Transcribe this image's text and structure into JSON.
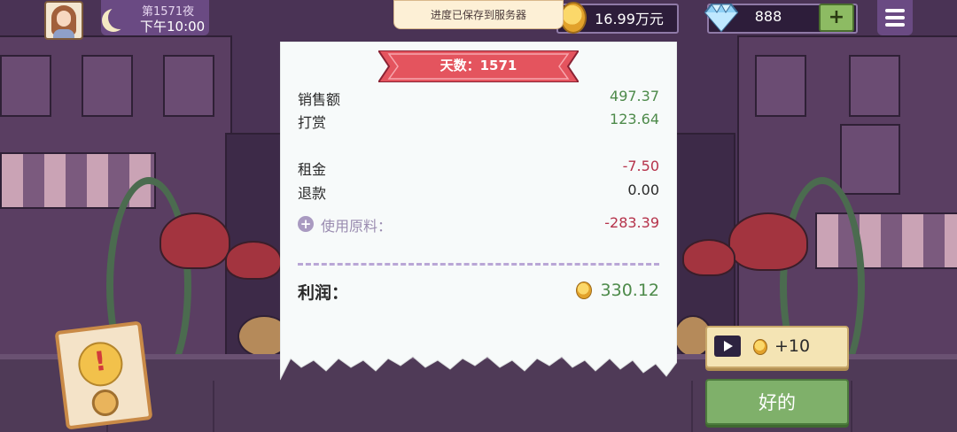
{
  "hud": {
    "day_label": "第1571夜",
    "time_label": "下午10:00",
    "save_toast": "进度已保存到服务器",
    "money": "16.99万元",
    "gems": "888",
    "plus_label": "+"
  },
  "receipt": {
    "title": "天数：1571",
    "rows": [
      {
        "label": "销售额",
        "value": "497.37"
      },
      {
        "label": "打赏",
        "value": "123.64"
      },
      {
        "label": "租金",
        "value": "-7.50"
      },
      {
        "label": "退款",
        "value": "0.00"
      }
    ],
    "materials": {
      "plus": "+",
      "label": "使用原料：",
      "value": "-283.39"
    },
    "profit": {
      "label": "利润：",
      "value": "330.12"
    }
  },
  "alert_card": {
    "mark": "!"
  },
  "buttons": {
    "ad_reward": "+10",
    "ok": "好的"
  },
  "colors": {
    "income_green": "#4d8a4a",
    "expense_red": "#b5324a",
    "ok_button": "#7fb06a",
    "ribbon_red": "#e4545e"
  },
  "icons": [
    "moon-icon",
    "coin-icon",
    "diamond-icon",
    "plus-icon",
    "menu-icon",
    "play-icon",
    "alert-icon"
  ]
}
